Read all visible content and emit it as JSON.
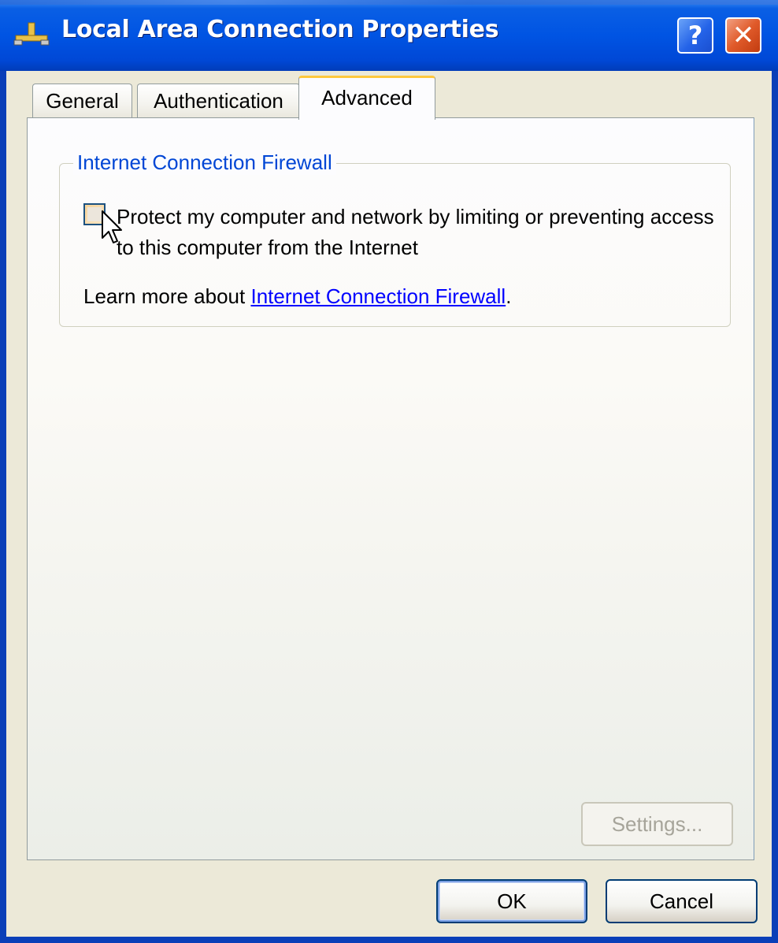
{
  "window": {
    "title": "Local Area Connection Properties",
    "title_icon": "network-connection-icon",
    "help_label": "?",
    "close_label": "✕"
  },
  "tabs": [
    {
      "label": "General",
      "selected": false
    },
    {
      "label": "Authentication",
      "selected": false
    },
    {
      "label": "Advanced",
      "selected": true
    }
  ],
  "firewall_group": {
    "legend": "Internet Connection Firewall",
    "checkbox_label": "Protect my computer and network by limiting or preventing access to this computer from the Internet",
    "checkbox_checked": false,
    "learn_more_prefix": "Learn more about ",
    "learn_more_link": "Internet Connection Firewall",
    "learn_more_suffix": "."
  },
  "buttons": {
    "settings": "Settings...",
    "ok": "OK",
    "cancel": "Cancel"
  },
  "colors": {
    "titlebar": "#0054e3",
    "dialog_bg": "#ece9d8",
    "group_legend": "#0046d5",
    "link": "#0000ff",
    "tab_highlight": "#ffc83c"
  }
}
